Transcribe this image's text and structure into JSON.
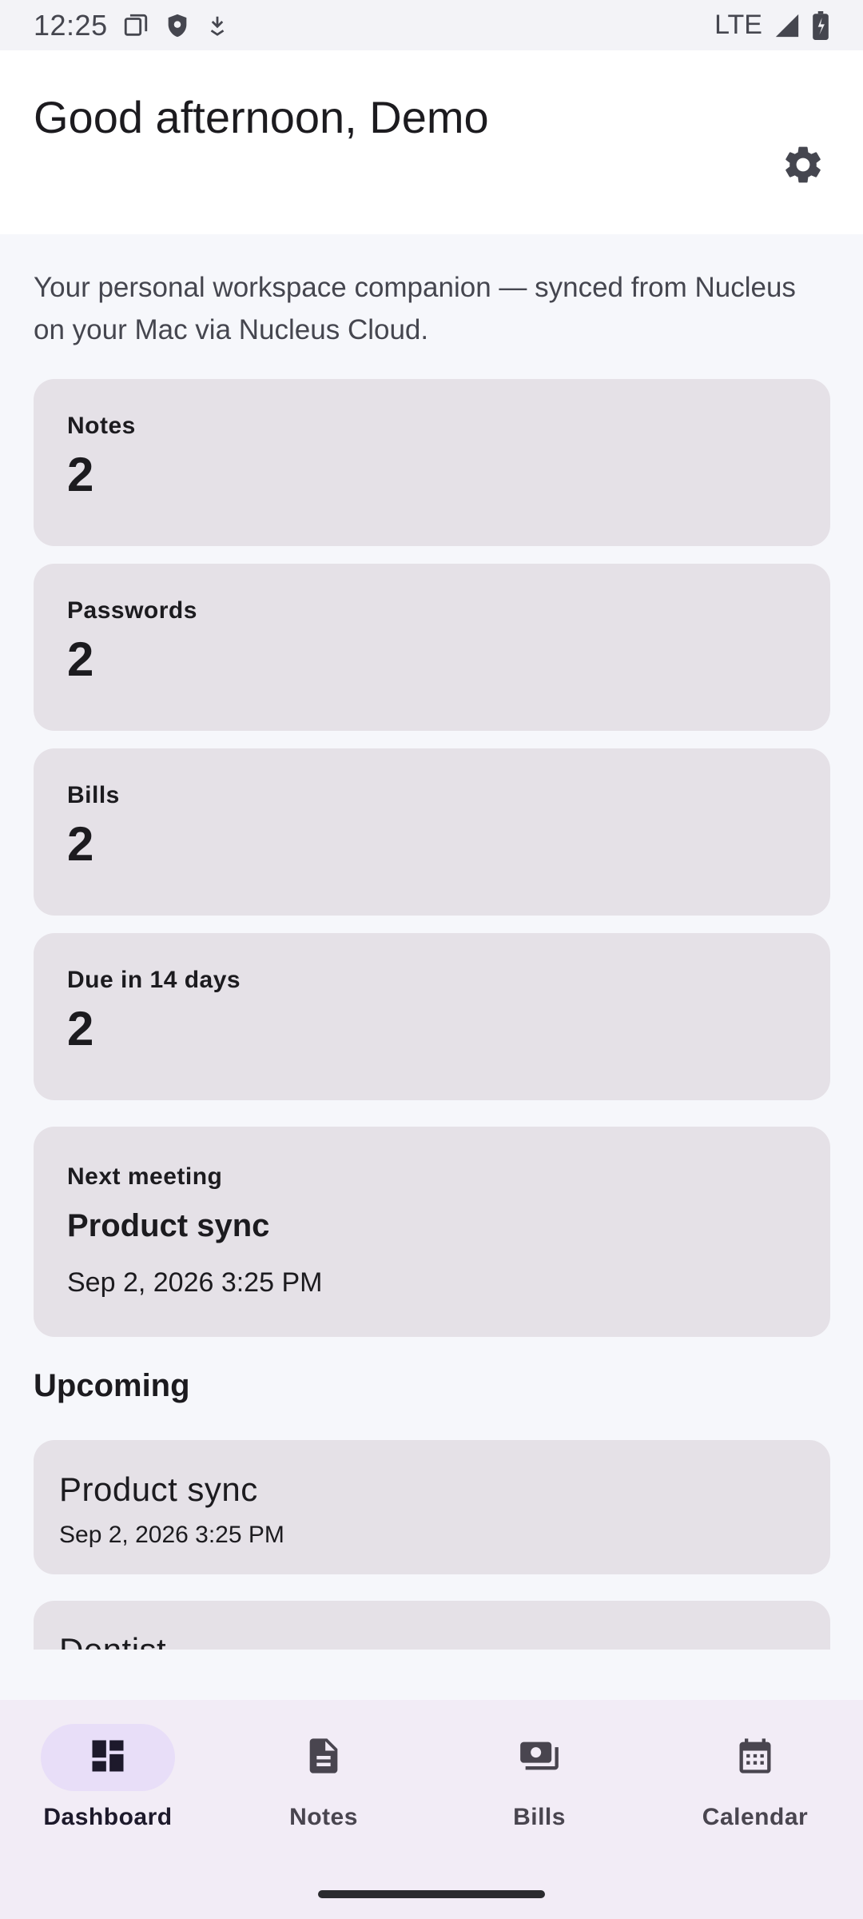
{
  "status_bar": {
    "time": "12:25",
    "network": "LTE",
    "icons": [
      "screenshot-icon",
      "shield-icon",
      "download-icon",
      "signal-icon",
      "battery-icon"
    ]
  },
  "header": {
    "greeting": "Good afternoon, Demo",
    "settings_icon": "gear-icon"
  },
  "main": {
    "subtitle": "Your personal workspace companion — synced from Nucleus on your Mac via Nucleus Cloud.",
    "stats": [
      {
        "label": "Notes",
        "value": "2"
      },
      {
        "label": "Passwords",
        "value": "2"
      },
      {
        "label": "Bills",
        "value": "2"
      },
      {
        "label": "Due in 14 days",
        "value": "2"
      }
    ],
    "next_meeting": {
      "label": "Next meeting",
      "title": "Product sync",
      "time": "Sep 2, 2026 3:25 PM"
    },
    "upcoming_title": "Upcoming",
    "upcoming": [
      {
        "title": "Product sync",
        "time": "Sep 2, 2026 3:25 PM"
      },
      {
        "title": "Dentist",
        "time": ""
      }
    ]
  },
  "nav": {
    "items": [
      {
        "label": "Dashboard",
        "icon": "dashboard-icon",
        "active": true
      },
      {
        "label": "Notes",
        "icon": "note-icon",
        "active": false
      },
      {
        "label": "Bills",
        "icon": "payments-icon",
        "active": false
      },
      {
        "label": "Calendar",
        "icon": "calendar-icon",
        "active": false
      }
    ]
  },
  "colors": {
    "background": "#f6f7fb",
    "card": "#e5e1e7",
    "nav_background": "#f2ecf6",
    "nav_active_pill": "#e8def8"
  }
}
